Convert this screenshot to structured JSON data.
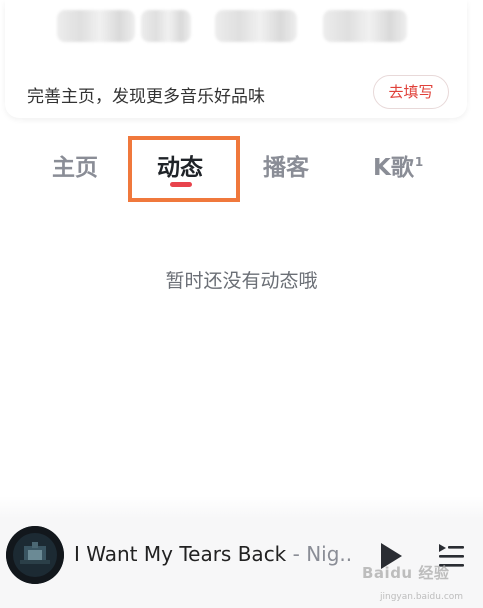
{
  "profile_card": {
    "prompt": "完善主页，发现更多音乐好品味",
    "fill_button": "去填写"
  },
  "tabs": [
    {
      "label": "主页",
      "badge": ""
    },
    {
      "label": "动态",
      "badge": "",
      "active": true
    },
    {
      "label": "播客",
      "badge": ""
    },
    {
      "label": "K歌",
      "badge": "1"
    }
  ],
  "feed": {
    "empty_message": "暂时还没有动态哦"
  },
  "player": {
    "song_title": "I Want My Tears Back",
    "artist": " - Nig...",
    "icons": [
      "play-icon",
      "playlist-icon"
    ]
  },
  "watermark": {
    "text": "Baidu 经验",
    "sub": "jingyan.baidu.com"
  },
  "colors": {
    "accent_red": "#e8434c",
    "highlight_orange": "#f0783c",
    "tab_inactive": "#8a8d96"
  }
}
